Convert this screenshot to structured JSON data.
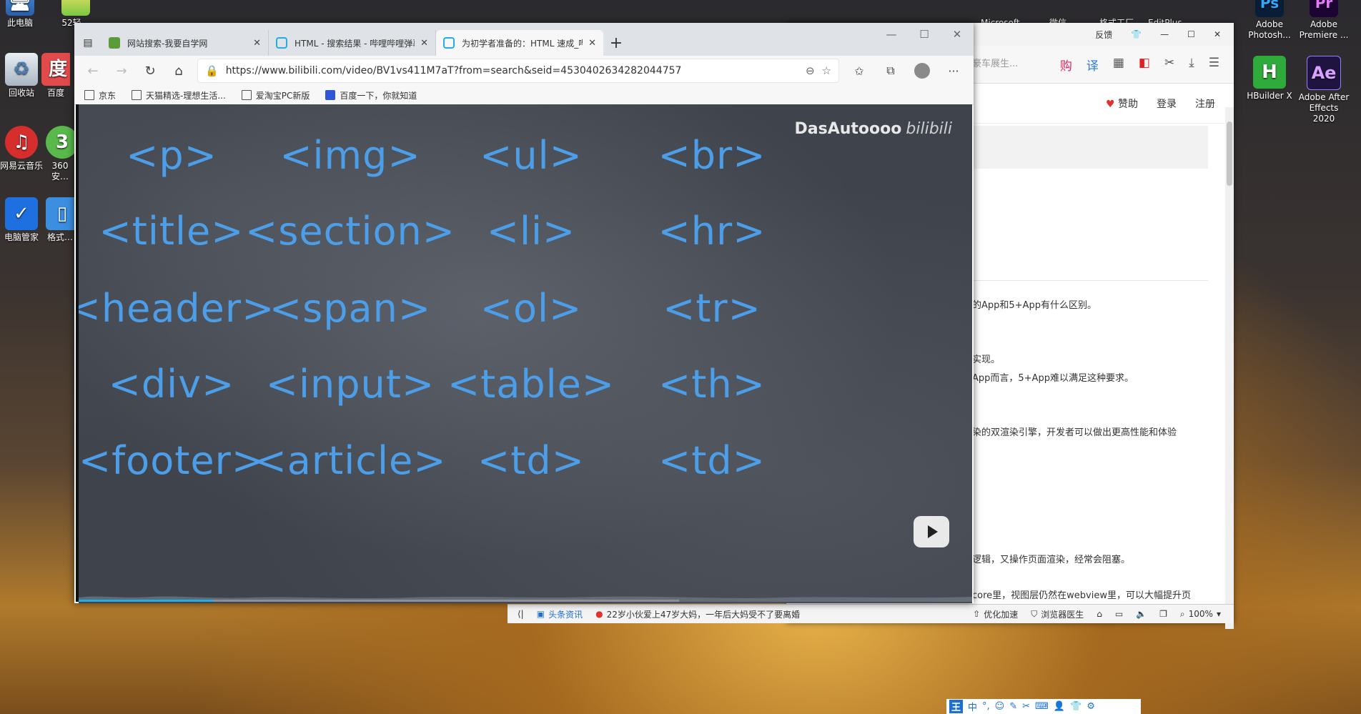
{
  "desktop": {
    "icons_left": [
      {
        "label": "此电脑",
        "icon": "computer-icon"
      },
      {
        "label": "52轻…",
        "icon": "app-icon"
      },
      {
        "label": "回收站",
        "icon": "recycle-bin-icon"
      },
      {
        "label": "百度",
        "icon": "baidu-icon"
      },
      {
        "label": "网易云音乐",
        "icon": "netease-music-icon"
      },
      {
        "label": "360安…",
        "icon": "360-icon"
      },
      {
        "label": "电脑管家",
        "icon": "pc-manager-icon"
      },
      {
        "label": "格式…",
        "icon": "app-icon"
      }
    ],
    "icons_right": [
      {
        "label": "Adobe Photosh...",
        "glyph": "Ps",
        "color": "#2b0f4a"
      },
      {
        "label": "Adobe Premiere ...",
        "glyph": "Pr",
        "color": "#2b0f4a"
      },
      {
        "label": "HBuilder X",
        "glyph": "H",
        "color": "#2fab3b"
      },
      {
        "label": "Adobe After Effects 2020",
        "glyph": "Ae",
        "color": "#1f1440"
      }
    ],
    "top_partial_labels": [
      "Microsoft",
      "微信",
      "格式工厂",
      "EditPlus"
    ]
  },
  "edge": {
    "tabs": [
      {
        "label": "网站搜索-我要自学网",
        "active": false,
        "icon": "zixue-icon"
      },
      {
        "label": "HTML - 搜索结果 - 哔哩哔哩弹幕",
        "active": false,
        "icon": "bilibili-icon"
      },
      {
        "label": "为初学者准备的：HTML 速成_哔",
        "active": true,
        "icon": "bilibili-icon"
      }
    ],
    "url": "https://www.bilibili.com/video/BV1vs411M7aT?from=search&seid=4530402634282044757",
    "bookmarks": [
      {
        "label": "京东",
        "icon": "page-icon"
      },
      {
        "label": "天猫精选-理想生活...",
        "icon": "page-icon"
      },
      {
        "label": "爱淘宝PC新版",
        "icon": "page-icon"
      },
      {
        "label": "百度一下，你就知道",
        "icon": "baidu-paw-icon"
      }
    ]
  },
  "video": {
    "watermark": "DasAutoooo",
    "watermark_logo": "bilibili",
    "tags": [
      [
        "<p>",
        "<img>",
        "<ul>",
        "<br>"
      ],
      [
        "<title>",
        "<section>",
        "<li>",
        "<hr>"
      ],
      [
        "<header>",
        "<span>",
        "<ol>",
        "<tr>"
      ],
      [
        "<div>",
        "<input>",
        "<table>",
        "<th>"
      ],
      [
        "<footer>",
        "<article>",
        "<td>",
        "<td>"
      ]
    ],
    "played_fraction": 0.15,
    "buffered_fraction": 0.67
  },
  "bg_browser": {
    "title_items": [
      "反馈"
    ],
    "search_fragment": "豪车展生...",
    "site_links": {
      "sponsor": "赞助",
      "login": "登录",
      "register": "注册"
    },
    "lines": [
      "的App和5+App有什么区别。",
      "实现。",
      "App而言，5+App难以满足这种要求。",
      "染的双渲染引擎，开发者可以做出更高性能和体验",
      "逻辑，又操作页面渲染，经常会阻塞。",
      "core里，视图层仍然在webview里，可以大幅提升页"
    ],
    "status": {
      "news": "头条资讯",
      "headline": "22岁小伙爱上47岁大妈，一年后大妈受不了要离婚",
      "optimize": "优化加速",
      "doctor": "浏览器医生",
      "zoom": "100%"
    }
  },
  "ime": {
    "items": [
      "王",
      "中",
      "°,",
      "☺",
      "✎",
      "✂",
      "⌨",
      "👤",
      "👕",
      "⚙"
    ]
  }
}
